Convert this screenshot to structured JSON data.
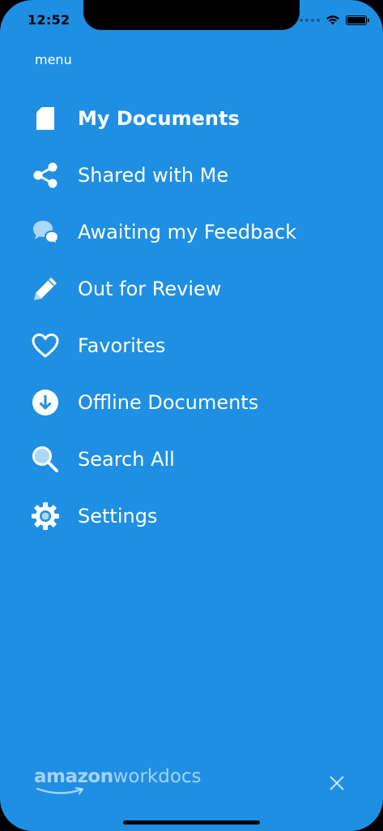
{
  "status_bar": {
    "time": "12:52"
  },
  "menu": {
    "title": "menu",
    "items": [
      {
        "label": "My Documents",
        "icon": "document-icon",
        "active": true
      },
      {
        "label": "Shared with Me",
        "icon": "share-icon",
        "active": false
      },
      {
        "label": "Awaiting my Feedback",
        "icon": "chat-bubbles-icon",
        "active": false
      },
      {
        "label": "Out for Review",
        "icon": "pencil-icon",
        "active": false
      },
      {
        "label": "Favorites",
        "icon": "heart-icon",
        "active": false
      },
      {
        "label": "Offline Documents",
        "icon": "download-icon",
        "active": false
      },
      {
        "label": "Search All",
        "icon": "search-icon",
        "active": false
      },
      {
        "label": "Settings",
        "icon": "gear-icon",
        "active": false
      }
    ]
  },
  "footer": {
    "logo_brand": "amazon",
    "logo_product": "workdocs",
    "close_icon": "close-icon"
  },
  "colors": {
    "background": "#1f8fe3",
    "text": "#ffffff",
    "icon_light": "#aad7fa"
  }
}
